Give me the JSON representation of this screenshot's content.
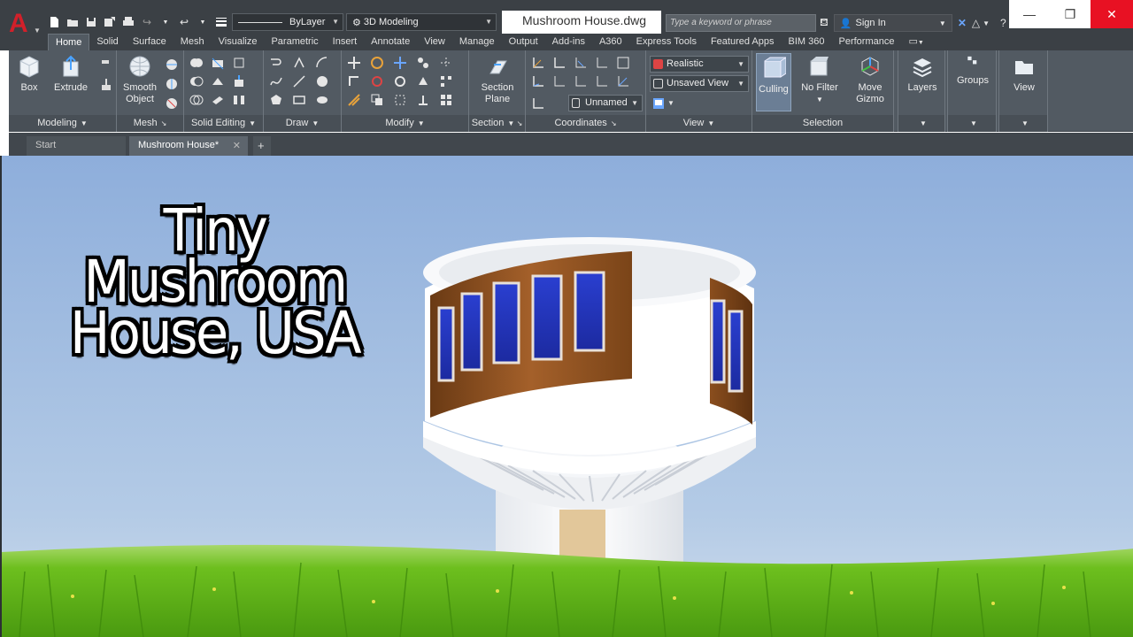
{
  "app": {
    "logo_letter": "A",
    "document_title": "Mushroom House.dwg",
    "search_placeholder": "Type a keyword or phrase",
    "sign_in_label": "Sign In"
  },
  "quick_access": {
    "layer_combo": "ByLayer",
    "workspace_combo": "3D Modeling"
  },
  "ribbon_tabs": [
    {
      "label": "Home",
      "active": true
    },
    {
      "label": "Solid"
    },
    {
      "label": "Surface"
    },
    {
      "label": "Mesh"
    },
    {
      "label": "Visualize"
    },
    {
      "label": "Parametric"
    },
    {
      "label": "Insert"
    },
    {
      "label": "Annotate"
    },
    {
      "label": "View"
    },
    {
      "label": "Manage"
    },
    {
      "label": "Output"
    },
    {
      "label": "Add-ins"
    },
    {
      "label": "A360"
    },
    {
      "label": "Express Tools"
    },
    {
      "label": "Featured Apps"
    },
    {
      "label": "BIM 360"
    },
    {
      "label": "Performance"
    }
  ],
  "panels": {
    "modeling": {
      "title": "Modeling",
      "box": "Box",
      "extrude": "Extrude"
    },
    "mesh": {
      "title": "Mesh",
      "smooth_line1": "Smooth",
      "smooth_line2": "Object"
    },
    "solid_editing": {
      "title": "Solid Editing"
    },
    "draw": {
      "title": "Draw"
    },
    "modify": {
      "title": "Modify"
    },
    "section": {
      "title": "Section",
      "plane_line1": "Section",
      "plane_line2": "Plane"
    },
    "coordinates": {
      "title": "Coordinates",
      "ucs_combo": "Unnamed"
    },
    "view": {
      "title": "View",
      "visual_style": "Realistic",
      "named_view": "Unsaved View"
    },
    "selection": {
      "title": "Selection",
      "culling": "Culling",
      "no_filter": "No Filter",
      "move_gizmo_line1": "Move",
      "move_gizmo_line2": "Gizmo"
    },
    "layers": {
      "title": "Layers"
    },
    "groups": {
      "title": "Groups"
    },
    "view_btn": {
      "title": "View"
    }
  },
  "doc_tabs": {
    "start": "Start",
    "active": "Mushroom House*",
    "add": "+"
  },
  "viewport": {
    "overlay_line1": "Tiny Mushroom",
    "overlay_line2": "House, USA"
  },
  "colors": {
    "accent_red": "#d2202a",
    "ribbon_bg": "#525a62",
    "titlebar_bg": "#3b4045",
    "sky_top": "#8fb0dc",
    "grass": "#5cb71a"
  }
}
